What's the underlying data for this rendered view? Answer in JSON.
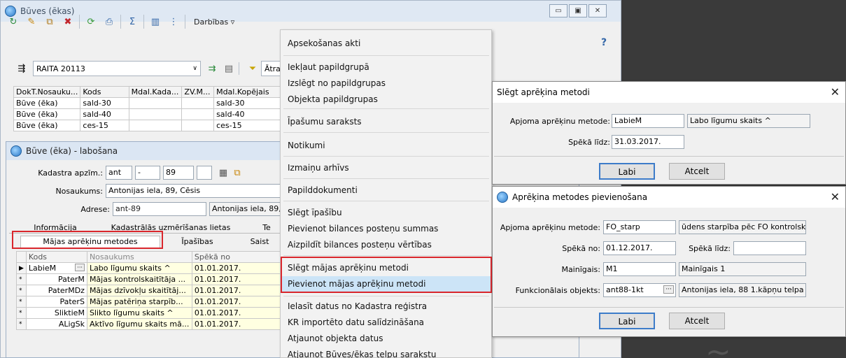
{
  "main": {
    "title": "Būves (ēkas)",
    "toolbar_actions_label": "Darbības ▿",
    "help_glyph": "?",
    "combo_value": "RAITA 20113",
    "filter_label": "Ātra",
    "grid_headers": [
      "DokT.Nosauku...",
      "Kods",
      "Mdal.Kada...",
      "ZV.M...",
      "Mdal.Kopējais"
    ],
    "grid_rows": [
      [
        "Būve (ēka)",
        "sald-30",
        "",
        "",
        "sald-30"
      ],
      [
        "Būve (ēka)",
        "sald-40",
        "",
        "",
        "sald-40"
      ],
      [
        "Būve (ēka)",
        "ces-15",
        "",
        "",
        "ces-15"
      ]
    ]
  },
  "edit": {
    "title": "Būve (ēka) - labošana",
    "kadastra_label": "Kadastra apzīm.:",
    "kadastra_1": "ant",
    "kadastra_2": "-",
    "kadastra_3": "89",
    "nosaukums_label": "Nosaukums:",
    "nosaukums_value": "Antonijas iela, 89, Cēsis",
    "adrese_label": "Adrese:",
    "adrese_code": "ant-89",
    "adrese_text": "Antonijas iela, 89, C",
    "tabs_row1": [
      "Informācija",
      "Kadastrālās uzmērīšanas lietas",
      "Te"
    ],
    "tabs_row2": [
      "Mājas aprēķinu metodes",
      "Īpašības",
      "Saist"
    ],
    "grid_headers": [
      "Kods",
      "Nosaukums",
      "Spēkā no"
    ],
    "rows": [
      {
        "mark": "▶",
        "code": "LabieM",
        "name": "Labo līgumu skaits ^",
        "date": "01.01.2017."
      },
      {
        "mark": "*",
        "code": "PaterM",
        "name": "Mājas kontrolskaitītāja ...",
        "date": "01.01.2017."
      },
      {
        "mark": "*",
        "code": "PaterMDz",
        "name": "Mājas dzīvokļu skaitītāj...",
        "date": "01.01.2017."
      },
      {
        "mark": "*",
        "code": "PaterS",
        "name": "Mājas patēriņa starpīb...",
        "date": "01.01.2017."
      },
      {
        "mark": "*",
        "code": "SliktieM",
        "name": "Slikto līgumu skaits ^",
        "date": "01.01.2017."
      },
      {
        "mark": "*",
        "code": "ALigSk",
        "name": "Aktīvo līgumu skaits mā...",
        "date": "01.01.2017."
      }
    ]
  },
  "menu": {
    "items": [
      "Apsekošanas akti",
      "Iekļaut papildgrupā",
      "Izslēgt no papildgrupas",
      "Objekta papildgrupas",
      "Īpašumu saraksts",
      "Notikumi",
      "Izmaiņu arhīvs",
      "Papilddokumenti",
      "Slēgt īpašību",
      "Pievienot bilances posteņu summas",
      "Aizpildīt bilances posteņu vērtības",
      "Slēgt mājas aprēķinu metodi",
      "Pievienot mājas aprēķinu metodi",
      "Ielasīt datus no Kadastra reģistra",
      "KR importēto datu salīdzināšana",
      "Atjaunot objekta datus",
      "Atjaunot Būves/ēkas telpu sarakstu"
    ]
  },
  "close_dialog": {
    "title": "Slēgt aprēķina metodi",
    "method_label": "Apjoma aprēķinu metode:",
    "method_code": "LabieM",
    "method_name": "Labo līgumu skaits ^",
    "until_label": "Spēkā līdz:",
    "until_value": "31.03.2017.",
    "ok": "Labi",
    "cancel": "Atcelt"
  },
  "add_dialog": {
    "title": "Aprēķina metodes pievienošana",
    "method_label": "Apjoma aprēķinu metode:",
    "method_code": "FO_starp",
    "method_name": "ūdens starpība pēc FO kontrolskai",
    "from_label": "Spēkā no:",
    "from_value": "01.12.2017.",
    "until_label": "Spēkā līdz:",
    "until_value": "",
    "var_label": "Mainīgais:",
    "var_code": "M1",
    "var_name": "Mainīgais 1",
    "func_label": "Funkcionālais objekts:",
    "func_code": "ant88-1kt",
    "func_name": "Antonijas iela, 88 1.kāpņu telpa",
    "ok": "Labi",
    "cancel": "Atcelt"
  },
  "colors": {
    "highlight_red": "#d9262c",
    "menu_selected": "#cce4f7",
    "yellow_cell": "#ffffe1"
  }
}
